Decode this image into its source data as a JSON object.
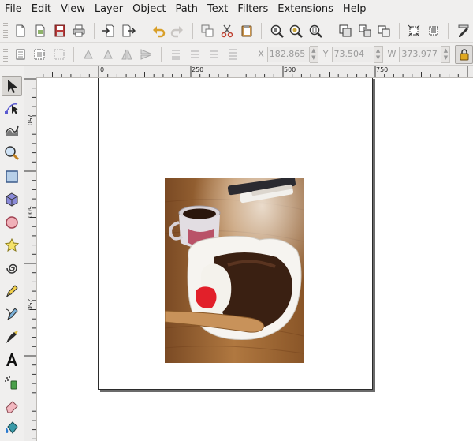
{
  "menu": {
    "items": [
      {
        "label": "File",
        "accel": "F",
        "rest": "ile"
      },
      {
        "label": "Edit",
        "accel": "E",
        "rest": "dit"
      },
      {
        "label": "View",
        "accel": "V",
        "rest": "iew"
      },
      {
        "label": "Layer",
        "accel": "L",
        "rest": "ayer"
      },
      {
        "label": "Object",
        "accel": "O",
        "rest": "bject"
      },
      {
        "label": "Path",
        "accel": "P",
        "rest": "ath"
      },
      {
        "label": "Text",
        "accel": "T",
        "rest": "ext"
      },
      {
        "label": "Filters",
        "accel": "F",
        "rest": "ilters"
      },
      {
        "label": "Extensions",
        "accel": "x",
        "pre": "E",
        "rest": "tensions"
      },
      {
        "label": "Help",
        "accel": "H",
        "rest": "elp"
      }
    ]
  },
  "toolbar2": {
    "x_label": "X",
    "x_value": "182.865",
    "y_label": "Y",
    "y_value": "73.504",
    "w_label": "W",
    "w_value": "373.977"
  },
  "rulers": {
    "h_labels": [
      "0",
      "250",
      "500",
      "750"
    ],
    "v_labels": [
      "750",
      "500",
      "250"
    ]
  },
  "icons": {
    "toolbar1": [
      "new-document-icon",
      "open-icon",
      "save-icon",
      "print-icon",
      "import-icon",
      "export-icon",
      "undo-icon",
      "redo-icon",
      "duplicate-icon",
      "cut-icon",
      "paste-icon",
      "zoom-selection-icon",
      "zoom-drawing-icon",
      "zoom-page-icon",
      "group-icon",
      "ungroup-icon",
      "clone-icon",
      "transform-icon",
      "align-icon",
      "xml-editor-icon"
    ],
    "tools": [
      "selector-tool-icon",
      "node-tool-icon",
      "tweak-tool-icon",
      "zoom-tool-icon",
      "rectangle-tool-icon",
      "3d-box-tool-icon",
      "ellipse-tool-icon",
      "star-tool-icon",
      "spiral-tool-icon",
      "pencil-tool-icon",
      "pen-tool-icon",
      "calligraphy-tool-icon",
      "text-tool-icon",
      "spray-tool-icon",
      "eraser-tool-icon",
      "bucket-tool-icon"
    ]
  },
  "colors": {
    "page_border": "#2b2b2b",
    "chrome_bg": "#f0efee",
    "canvas_bg": "#ffffff"
  }
}
